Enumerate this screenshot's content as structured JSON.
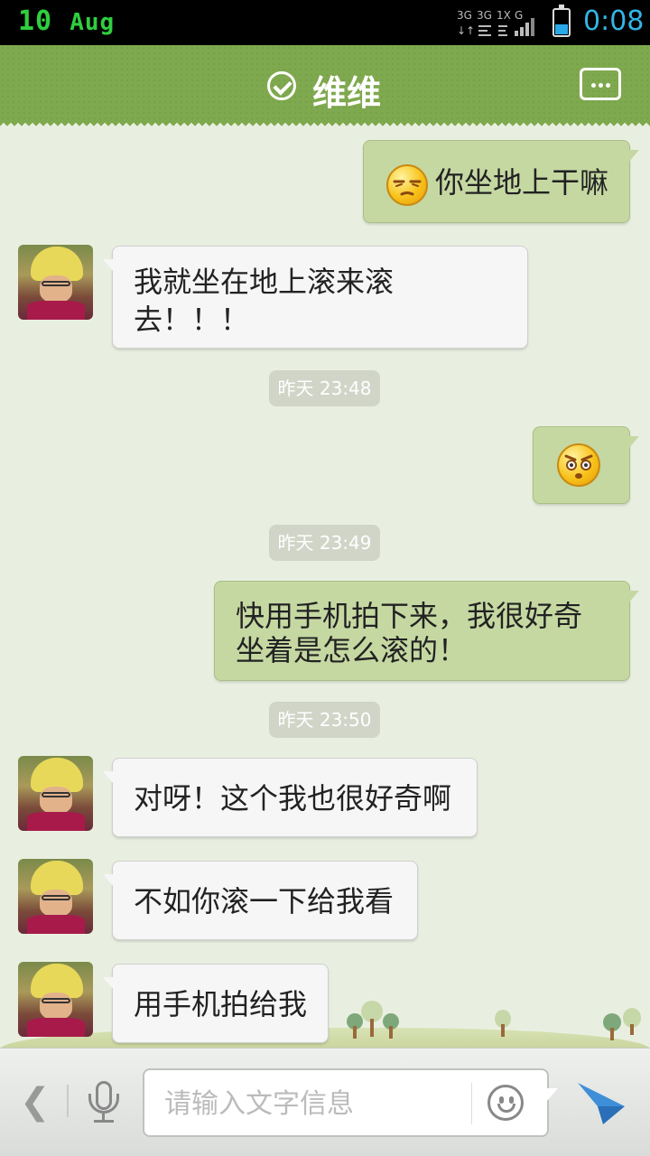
{
  "status_bar": {
    "date_day": "10",
    "date_month": "Aug",
    "time": "0:08",
    "network_labels": [
      "3G",
      "3G",
      "1X",
      "G"
    ],
    "battery_level_percent": 40
  },
  "header": {
    "title": "维维",
    "verified_icon": "check-circle-icon",
    "more_icon": "more-dots-icon"
  },
  "messages": [
    {
      "from": "me",
      "emoji": "squint-face",
      "text": "你坐地上干嘛"
    },
    {
      "from": "them",
      "lines": [
        "我就坐在地上滚来滚",
        "去！！！"
      ]
    },
    {
      "type": "timestamp",
      "text": "昨天 23:48"
    },
    {
      "from": "me",
      "emoji": "surprised-face",
      "text": ""
    },
    {
      "type": "timestamp",
      "text": "昨天 23:49"
    },
    {
      "from": "me",
      "lines": [
        "快用手机拍下来，我很好奇",
        "坐着是怎么滚的！"
      ]
    },
    {
      "type": "timestamp",
      "text": "昨天 23:50"
    },
    {
      "from": "them",
      "text": "对呀！这个我也很好奇啊"
    },
    {
      "from": "them",
      "text": "不如你滚一下给我看"
    },
    {
      "from": "them",
      "text": "用手机拍给我"
    }
  ],
  "input_bar": {
    "placeholder": "请输入文字信息",
    "back_icon": "chevron-left-icon",
    "mic_icon": "microphone-icon",
    "emoji_icon": "smiley-icon",
    "send_icon": "send-arrow-icon"
  },
  "colors": {
    "header": "#7fa94e",
    "background": "#e9efe0",
    "outgoing_bubble": "#c5d8a2",
    "incoming_bubble": "#f6f6f6",
    "time_accent": "#33b5e5",
    "date_green": "#2fcf3f"
  }
}
